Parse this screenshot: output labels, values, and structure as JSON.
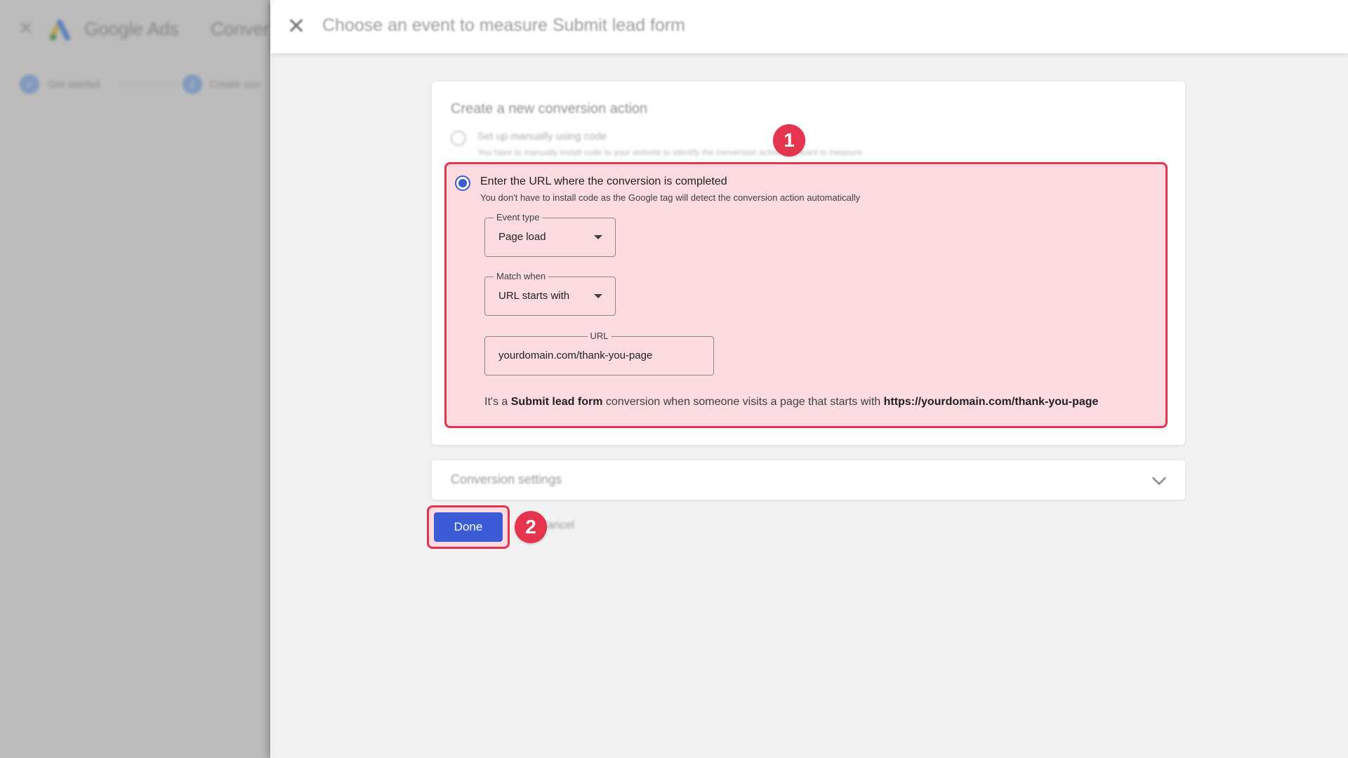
{
  "background": {
    "brand": "Google Ads",
    "section_partial": "Conver",
    "steps": [
      {
        "label": "Get started",
        "state": "done"
      },
      {
        "number": "2",
        "label": "Create con"
      }
    ]
  },
  "panel": {
    "title": "Choose an event to measure Submit lead form"
  },
  "card": {
    "title": "Create a new conversion action",
    "option_manual": {
      "label": "Set up manually using code",
      "description": "You have to manually install code to your website to identify the conversion action you want to measure",
      "selected": false
    },
    "option_url": {
      "label": "Enter the URL where the conversion is completed",
      "description": "You don't have to install code as the Google tag will detect the conversion action automatically",
      "selected": true
    },
    "event_type": {
      "label": "Event type",
      "value": "Page load"
    },
    "match_when": {
      "label": "Match when",
      "value": "URL starts with"
    },
    "url": {
      "label": "URL",
      "value": "yourdomain.com/thank-you-page"
    },
    "summary": {
      "prefix": "It's a",
      "action": "Submit lead form",
      "middle": "conversion when someone visits a page that starts with",
      "url": "https://yourdomain.com/thank-you-page"
    }
  },
  "settings": {
    "label": "Conversion settings"
  },
  "actions": {
    "done_label": "Done",
    "cancel_partial": "Cancel"
  },
  "annotations": {
    "badge_1": "1",
    "badge_2": "2"
  },
  "colors": {
    "accent": "#3b5bd6",
    "highlight": "#e5344d",
    "highlight_fill": "#fddbe0"
  }
}
